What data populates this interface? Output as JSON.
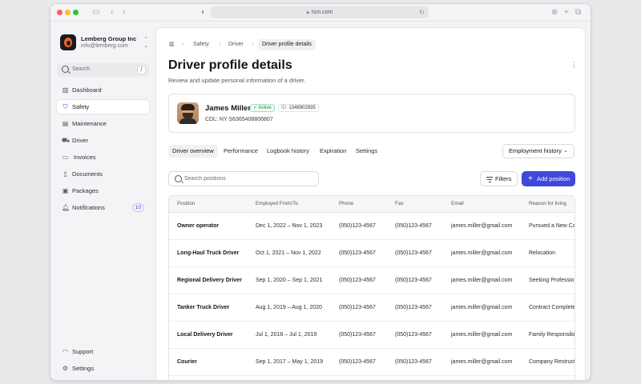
{
  "browser": {
    "url": "tsm.com"
  },
  "org": {
    "name": "Lemberg Group Inc",
    "email": "info@lemberg.com"
  },
  "sidebar": {
    "search_label": "Search",
    "search_shortcut": "/",
    "items": [
      {
        "label": "Dashboard",
        "icon": "bar-chart-icon"
      },
      {
        "label": "Safety",
        "icon": "shield-icon",
        "active": true
      },
      {
        "label": "Maintenance",
        "icon": "wrench-icon"
      },
      {
        "label": "Driver",
        "icon": "truck-icon"
      },
      {
        "label": "Invoices",
        "icon": "folder-icon"
      },
      {
        "label": "Documents",
        "icon": "document-icon"
      },
      {
        "label": "Packages",
        "icon": "package-icon"
      },
      {
        "label": "Notifications",
        "icon": "bell-icon",
        "badge": "10"
      }
    ],
    "bottom": [
      {
        "label": "Support",
        "icon": "headset-icon"
      },
      {
        "label": "Settings",
        "icon": "gear-icon"
      }
    ]
  },
  "breadcrumb": {
    "items": [
      "Safety",
      "Driver"
    ],
    "current": "Driver profile details"
  },
  "page": {
    "title": "Driver profile details",
    "subtitle": "Review and update personal information of a driver."
  },
  "driver": {
    "name": "James Miller",
    "status": "Active",
    "id_label": "ID:",
    "id_value": "1348902935",
    "cdl": "CDL: NY S6365408806807"
  },
  "tabs": [
    "Driver overview",
    "Performance",
    "Logbook history",
    "Expiration",
    "Settings"
  ],
  "employment_history_label": "Employment history",
  "toolbar": {
    "search_placeholder": "Search positions",
    "filters_label": "Filters",
    "add_label": "Add position"
  },
  "table": {
    "columns": [
      "Position",
      "Employed From/To",
      "Phone",
      "Fax",
      "Email",
      "Reason for living"
    ],
    "rows": [
      [
        "Owner operator",
        "Dec 1, 2022 – Nov 1, 2023",
        "(050)123-4567",
        "(050)123-4567",
        "james.miller@gmail.com",
        "Pursued a New Ca"
      ],
      [
        "Long-Haul Truck Driver",
        "Oct 1, 2021 – Nov 1, 2022",
        "(050)123-4567",
        "(050)123-4567",
        "james.miller@gmail.com",
        "Relocation"
      ],
      [
        "Regional Delivery Driver",
        "Sep 1, 2020 – Sep 1, 2021",
        "(050)123-4567",
        "(050)123-4567",
        "james.miller@gmail.com",
        "Seeking Professio"
      ],
      [
        "Tanker Truck Driver",
        "Aug 1, 2019 – Aug 1, 2020",
        "(050)123-4567",
        "(050)123-4567",
        "james.miller@gmail.com",
        "Contract Complete"
      ],
      [
        "Local Delivery Driver",
        "Jul 1, 2018 – Jul 1, 2019",
        "(050)123-4567",
        "(050)123-4567",
        "james.miller@gmail.com",
        "Family Responsibi"
      ],
      [
        "Courier",
        "Sep 1, 2017 – May 1, 2019",
        "(050)123-4567",
        "(050)123-4567",
        "james.miller@gmail.com",
        "Company Restruct"
      ]
    ]
  },
  "colors": {
    "accent": "#3f48d9",
    "active_green": "#1f8a47",
    "badge_blue": "#4450d8"
  }
}
